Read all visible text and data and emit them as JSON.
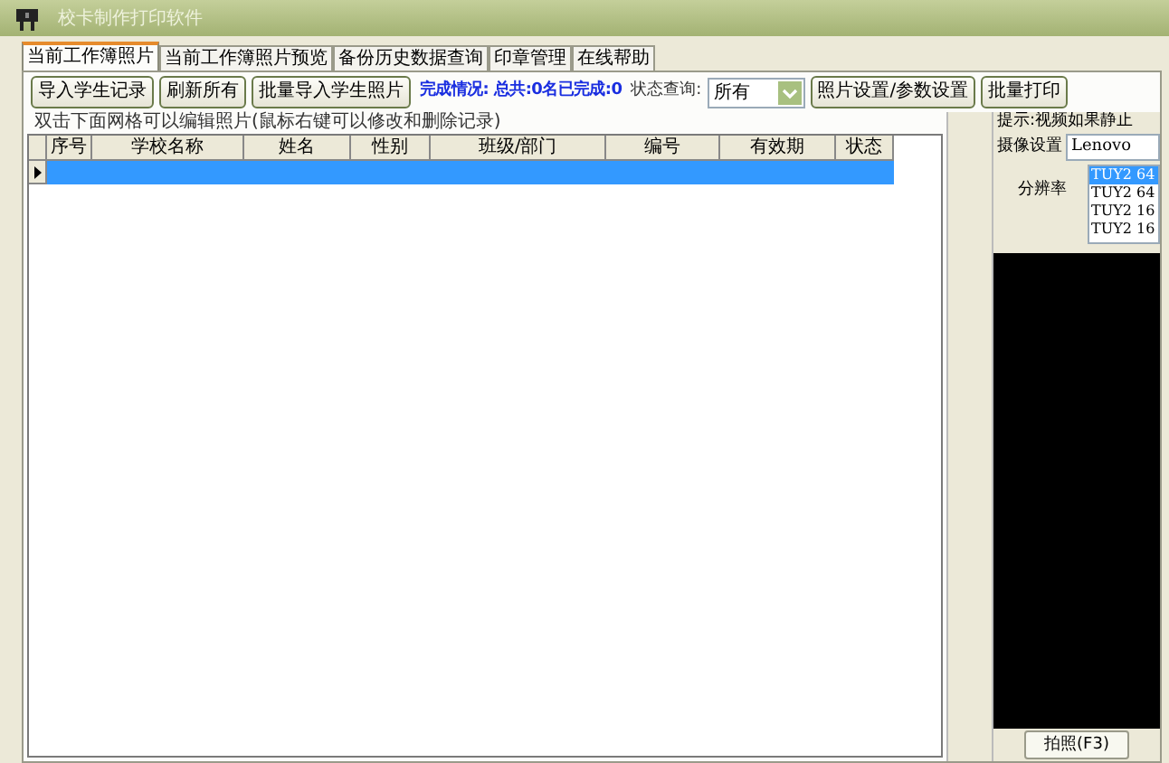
{
  "window": {
    "title": "校卡制作打印软件"
  },
  "tabs": [
    {
      "label": "当前工作簿照片",
      "selected": true
    },
    {
      "label": "当前工作簿照片预览",
      "selected": false
    },
    {
      "label": "备份历史数据查询",
      "selected": false
    },
    {
      "label": "印章管理",
      "selected": false
    },
    {
      "label": "在线帮助",
      "selected": false
    }
  ],
  "toolbar": {
    "buttons_left": [
      "导入学生记录",
      "刷新所有",
      "批量导入学生照片"
    ],
    "summary": "完成情况: 总共:0名已完成:0",
    "status_label": "状态查询:",
    "status_value": "所有",
    "buttons_right": [
      "照片设置/参数设置",
      "批量打印"
    ]
  },
  "grid": {
    "caption": "双击下面网格可以编辑照片(鼠标右键可以修改和删除记录)",
    "columns": [
      "序号",
      "学校名称",
      "姓名",
      "性别",
      "班级/部门",
      "编号",
      "有效期",
      "状态"
    ],
    "rows": [
      {
        "selected": true
      }
    ]
  },
  "camera_panel": {
    "hint": "提示:视频如果静止",
    "camera_label": "摄像设置",
    "camera_value": "Lenovo",
    "resolution_label": "分辨率",
    "resolutions": [
      {
        "label": "TUY2 64",
        "selected": true
      },
      {
        "label": "TUY2 64",
        "selected": false
      },
      {
        "label": "TUY2 16",
        "selected": false
      },
      {
        "label": "TUY2 16",
        "selected": false
      }
    ],
    "capture_button": "拍照(F3)"
  }
}
